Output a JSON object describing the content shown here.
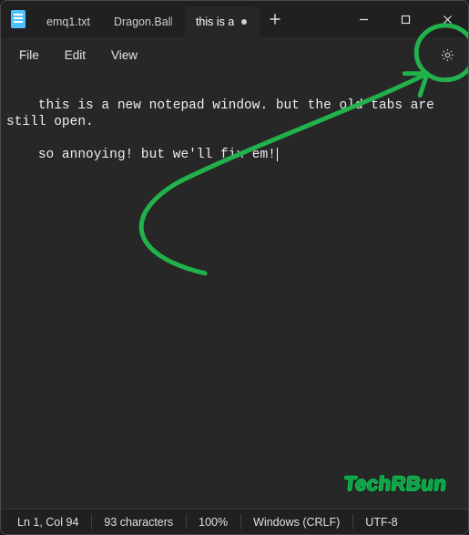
{
  "tabs": [
    {
      "label": "emq1.txt",
      "active": false,
      "dirty": false
    },
    {
      "label": "Dragon.Ball.S",
      "active": false,
      "dirty": false
    },
    {
      "label": "this is a",
      "active": true,
      "dirty": true
    }
  ],
  "menus": {
    "file": "File",
    "edit": "Edit",
    "view": "View"
  },
  "editor": {
    "line1": "this is a new notepad window. but the old tabs are still open.",
    "line2": "so annoying! but we'll fix em!"
  },
  "status": {
    "pos": "Ln 1, Col 94",
    "chars": "93 characters",
    "zoom": "100%",
    "eol": "Windows (CRLF)",
    "encoding": "UTF-8"
  },
  "watermark": "TechRBun",
  "annotation_color": "#22b24c"
}
